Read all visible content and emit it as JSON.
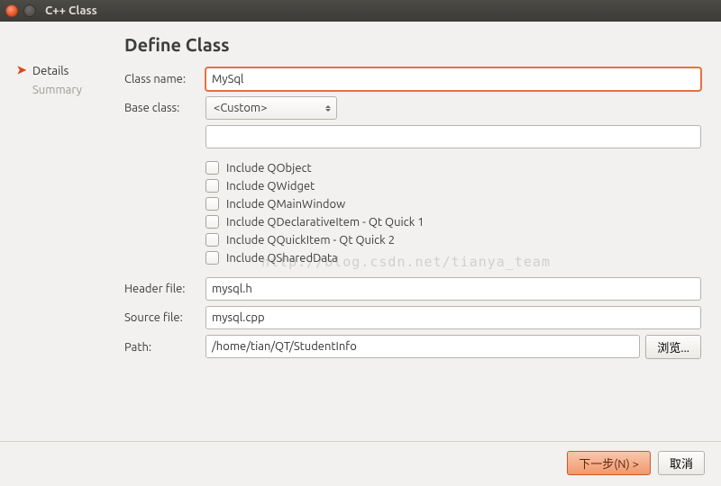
{
  "window": {
    "title": "C++ Class"
  },
  "sidebar": {
    "steps": [
      {
        "label": "Details",
        "active": true
      },
      {
        "label": "Summary",
        "active": false
      }
    ]
  },
  "page": {
    "title": "Define Class"
  },
  "fields": {
    "class_name": {
      "label": "Class name:",
      "value": "MySql"
    },
    "base_class": {
      "label": "Base class:",
      "value": "<Custom>",
      "custom_value": ""
    },
    "header_file": {
      "label": "Header file:",
      "value": "mysql.h"
    },
    "source_file": {
      "label": "Source file:",
      "value": "mysql.cpp"
    },
    "path": {
      "label": "Path:",
      "value": "/home/tian/QT/StudentInfo",
      "browse_label": "浏览..."
    }
  },
  "includes": [
    {
      "label": "Include QObject",
      "checked": false
    },
    {
      "label": "Include QWidget",
      "checked": false
    },
    {
      "label": "Include QMainWindow",
      "checked": false
    },
    {
      "label": "Include QDeclarativeItem - Qt Quick 1",
      "checked": false
    },
    {
      "label": "Include QQuickItem - Qt Quick 2",
      "checked": false
    },
    {
      "label": "Include QSharedData",
      "checked": false
    }
  ],
  "buttons": {
    "next": "下一步(N) >",
    "cancel": "取消"
  },
  "watermark": "http://blog.csdn.net/tianya_team"
}
